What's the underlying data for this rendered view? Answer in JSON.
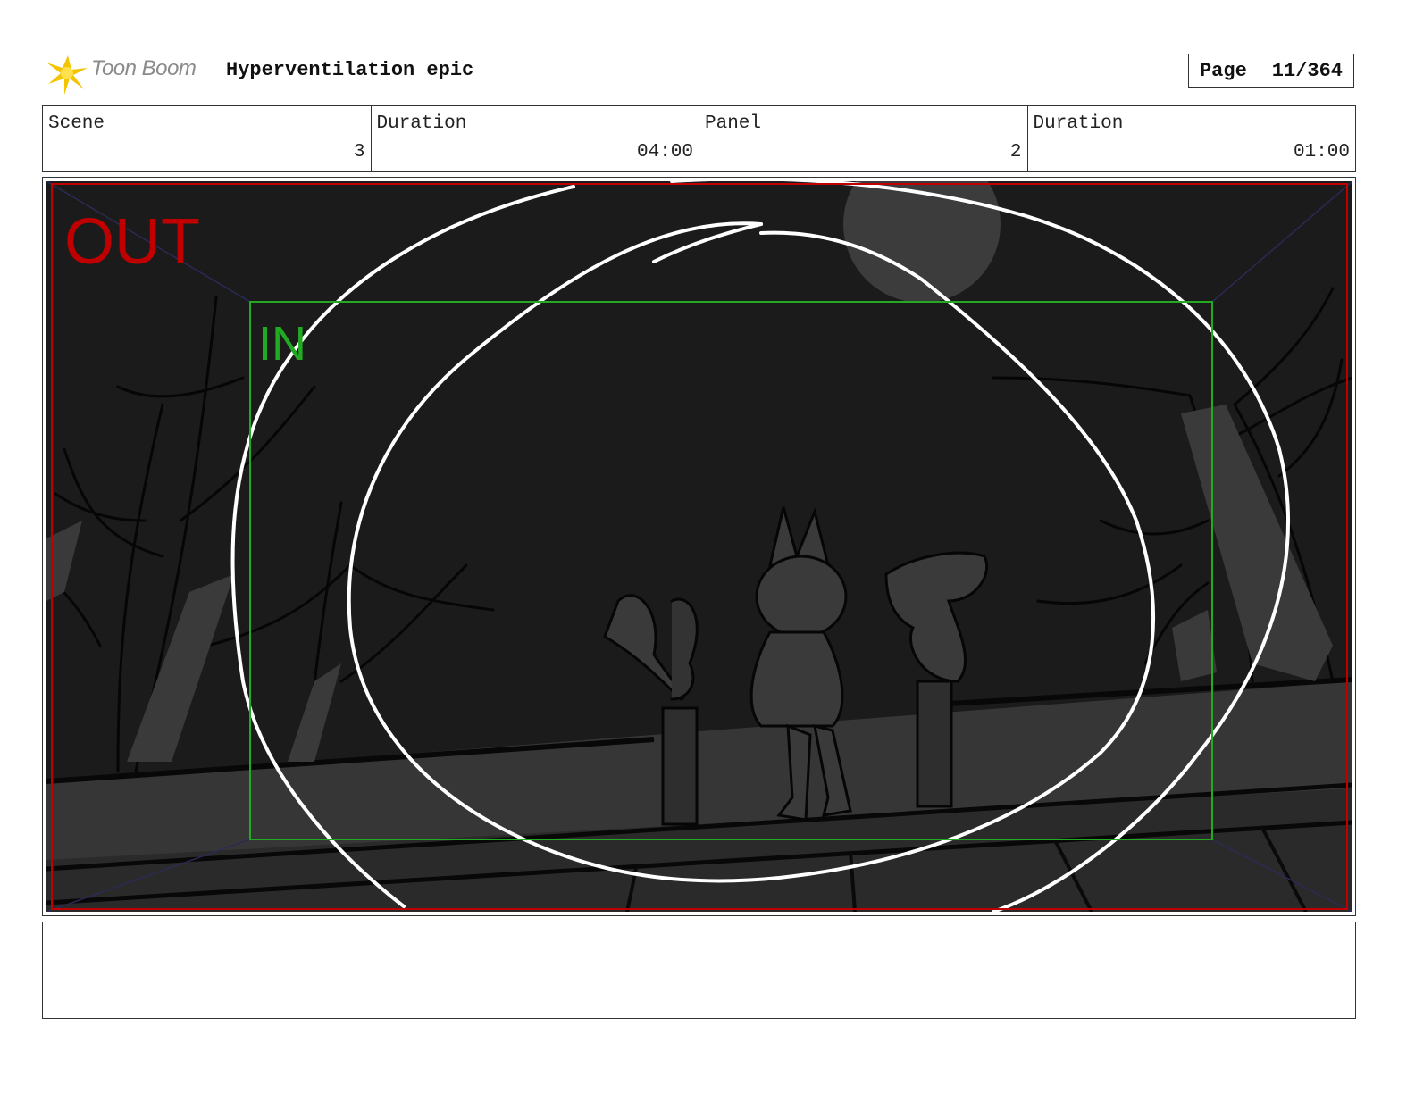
{
  "header": {
    "logo_text": "Toon Boom",
    "project_title": "Hyperventilation epic",
    "page_label": "Page",
    "page_value": "11/364"
  },
  "info": {
    "scene_label": "Scene",
    "scene_value": "3",
    "scene_duration_label": "Duration",
    "scene_duration_value": "04:00",
    "panel_label": "Panel",
    "panel_value": "2",
    "panel_duration_label": "Duration",
    "panel_duration_value": "01:00"
  },
  "panel": {
    "out_label": "OUT",
    "in_label": "IN"
  },
  "notes": {
    "text": ""
  },
  "colors": {
    "out_frame": "#c00000",
    "in_frame": "#22aa22",
    "logo_flare": "#f5c400",
    "background_sketch": "#1b1b1b"
  }
}
